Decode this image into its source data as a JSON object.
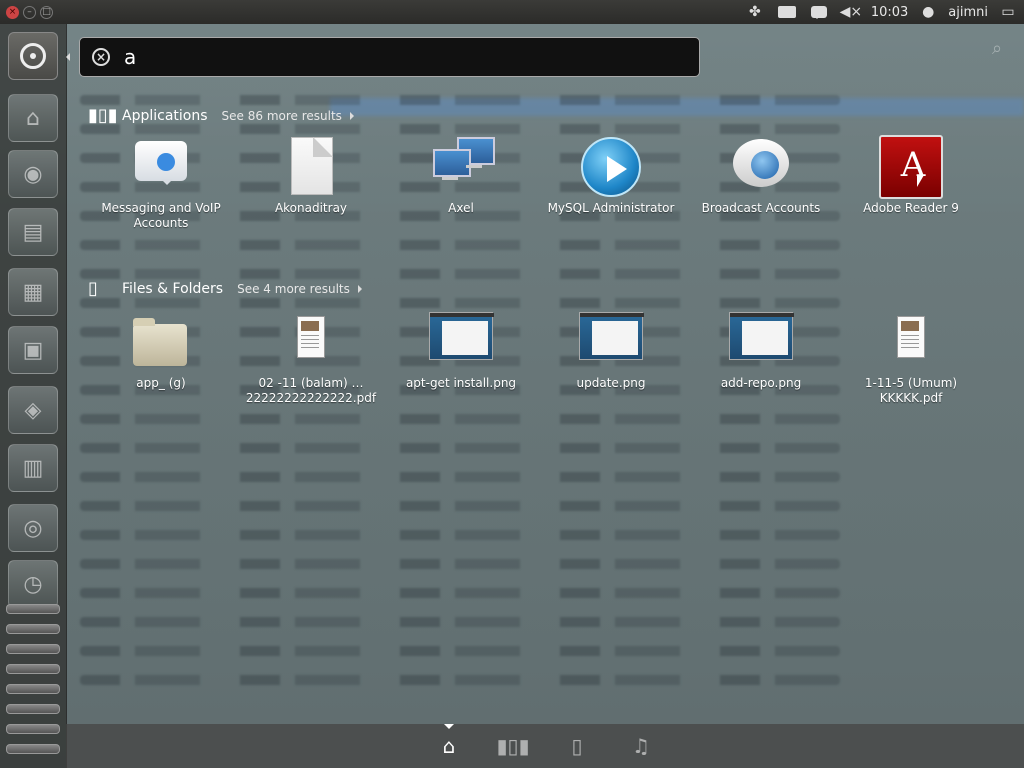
{
  "panel": {
    "clock": "10:03",
    "user": "ajimni"
  },
  "search": {
    "query": "a"
  },
  "applications": {
    "title": "Applications",
    "more": "See 86 more results",
    "items": [
      {
        "label": "Messaging and VoIP Accounts",
        "icon": "messaging-icon"
      },
      {
        "label": "Akonaditray",
        "icon": "document-icon"
      },
      {
        "label": "Axel",
        "icon": "network-icon"
      },
      {
        "label": "MySQL Administrator",
        "icon": "play-icon"
      },
      {
        "label": "Broadcast Accounts",
        "icon": "globe-icon"
      },
      {
        "label": "Adobe Reader 9",
        "icon": "adobe-reader-icon"
      }
    ]
  },
  "files": {
    "title": "Files & Folders",
    "more": "See 4 more results",
    "items": [
      {
        "label": "app_ (g)",
        "icon": "folder-icon"
      },
      {
        "label": "02 -11 (balam) …22222222222222.pdf",
        "icon": "pdf-icon"
      },
      {
        "label": "apt-get install.png",
        "icon": "screenshot-icon"
      },
      {
        "label": "update.png",
        "icon": "screenshot-icon"
      },
      {
        "label": "add-repo.png",
        "icon": "screenshot-icon"
      },
      {
        "label": "1-11-5 (Umum) KKKKK.pdf",
        "icon": "pdf-icon"
      }
    ]
  },
  "lenses": [
    "home-lens-icon",
    "applications-lens-icon",
    "files-lens-icon",
    "music-lens-icon"
  ]
}
